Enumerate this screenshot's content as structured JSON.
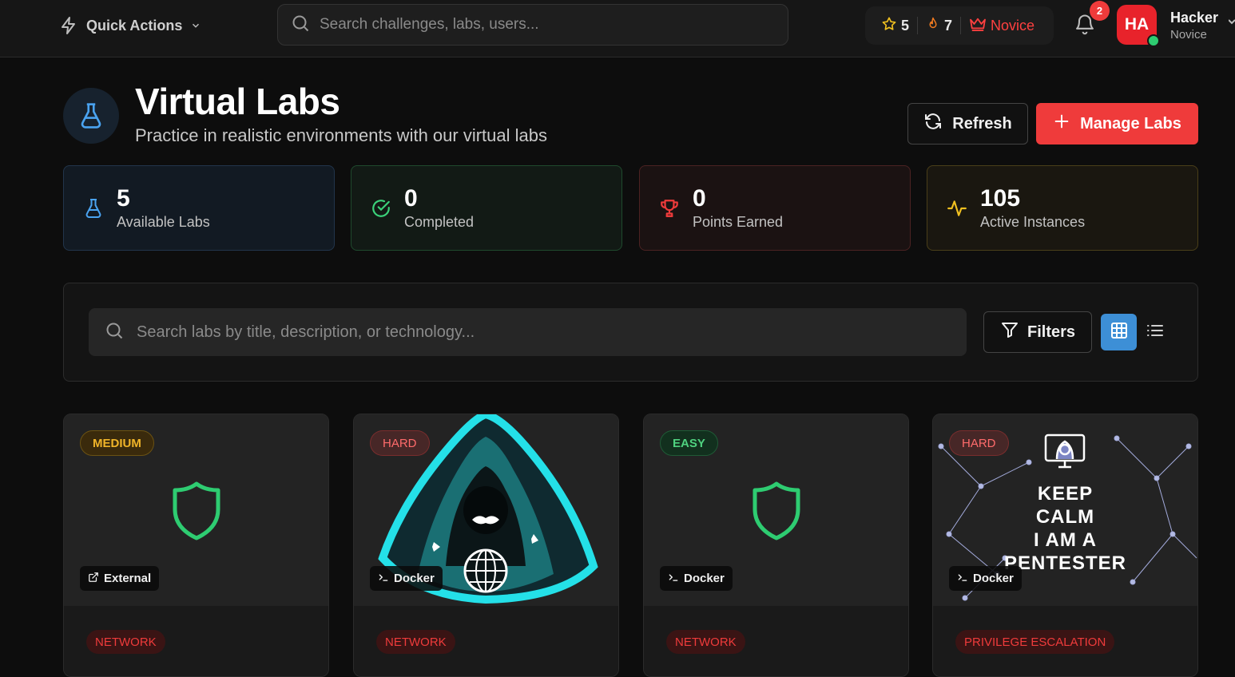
{
  "topbar": {
    "quick_actions": "Quick Actions",
    "search_placeholder": "Search challenges, labs, users...",
    "stars": "5",
    "streak": "7",
    "rank": "Novice",
    "notification_count": "2",
    "avatar_initials": "HA",
    "user_name": "Hacker",
    "user_rank": "Novice"
  },
  "header": {
    "title": "Virtual Labs",
    "subtitle": "Practice in realistic environments with our virtual labs",
    "refresh_label": "Refresh",
    "manage_label": "Manage Labs"
  },
  "stats": [
    {
      "value": "5",
      "label": "Available Labs",
      "icon": "flask-icon"
    },
    {
      "value": "0",
      "label": "Completed",
      "icon": "check-circle-icon"
    },
    {
      "value": "0",
      "label": "Points Earned",
      "icon": "trophy-icon"
    },
    {
      "value": "105",
      "label": "Active Instances",
      "icon": "activity-icon"
    }
  ],
  "filters": {
    "search_placeholder": "Search labs by title, description, or technology...",
    "filters_label": "Filters",
    "view_mode": "grid"
  },
  "labs": [
    {
      "difficulty": "MEDIUM",
      "tech": "External",
      "category": "NETWORK",
      "image": "shield-icon"
    },
    {
      "difficulty": "HARD",
      "tech": "Docker",
      "category": "NETWORK",
      "image": "hooded-hacker-image"
    },
    {
      "difficulty": "EASY",
      "tech": "Docker",
      "category": "NETWORK",
      "image": "shield-icon"
    },
    {
      "difficulty": "HARD",
      "tech": "Docker",
      "category": "PRIVILEGE ESCALATION",
      "image": "keep-calm-image",
      "image_text": [
        "KEEP",
        "CALM",
        "I AM A",
        "PENTESTER"
      ]
    }
  ],
  "colors": {
    "accent_red": "#ef3b3b",
    "accent_blue": "#3d8fd6",
    "success_green": "#2ecc71",
    "warning_yellow": "#f0b429"
  }
}
